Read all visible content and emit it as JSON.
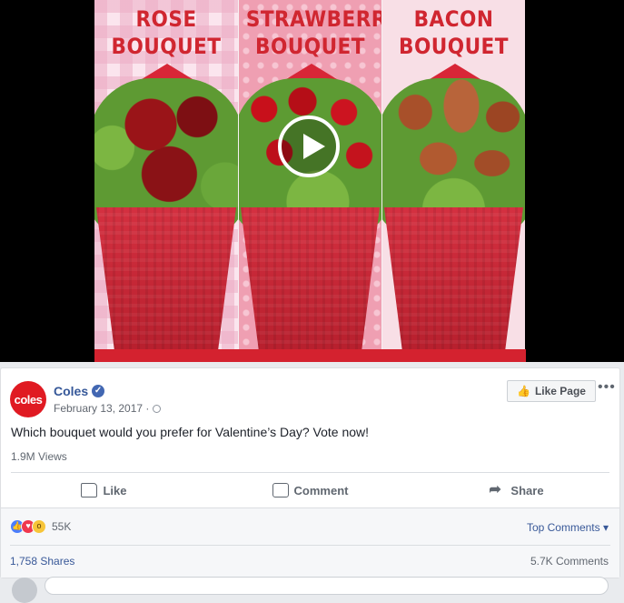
{
  "video": {
    "panels": [
      {
        "line1": "ROSE",
        "line2": "BOUQUET"
      },
      {
        "line1": "STRAWBERRY",
        "line2": "BOUQUET"
      },
      {
        "line1": "BACON",
        "line2": "BOUQUET"
      }
    ],
    "play_icon": "play-icon"
  },
  "post": {
    "avatar_text": "coles",
    "page_name": "Coles",
    "verified_icon": "verified-badge-icon",
    "date": "February 13, 2017 ·",
    "like_page_label": "Like Page",
    "more_label": "•••",
    "text": "Which bouquet would you prefer for Valentine’s Day? Vote now!",
    "views": "1.9M Views"
  },
  "actions": {
    "like": "Like",
    "comment": "Comment",
    "share": "Share"
  },
  "stats": {
    "reactions": [
      "like",
      "love",
      "wow"
    ],
    "reaction_count": "55K",
    "top_comments": "Top Comments ▾",
    "shares": "1,758 Shares",
    "comments": "5.7K Comments"
  },
  "colors": {
    "facebook_blue": "#4267b2",
    "link_blue": "#385898",
    "coles_red": "#e01a22"
  }
}
